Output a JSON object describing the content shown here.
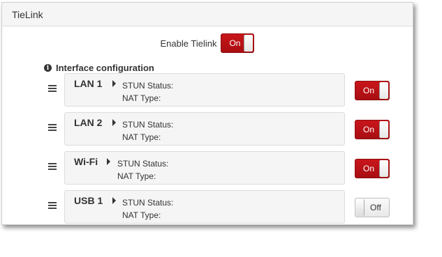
{
  "panel": {
    "title": "TieLink"
  },
  "enable": {
    "label": "Enable Tielink",
    "state": "On"
  },
  "section": {
    "title": "Interface configuration"
  },
  "interfaces": [
    {
      "name": "LAN 1",
      "stun_label": "STUN Status:",
      "nat_label": "NAT Type:",
      "toggle": "On"
    },
    {
      "name": "LAN 2",
      "stun_label": "STUN Status:",
      "nat_label": "NAT Type:",
      "toggle": "On"
    },
    {
      "name": "Wi-Fi",
      "stun_label": "STUN Status:",
      "nat_label": "NAT Type:",
      "toggle": "On"
    },
    {
      "name": "USB 1",
      "stun_label": "STUN Status:",
      "nat_label": "NAT Type:",
      "toggle": "Off"
    }
  ],
  "colors": {
    "toggle_on": "#b5121b",
    "toggle_off": "#eeeeee",
    "row_bg": "#f5f5f5"
  },
  "icons": {
    "info": "info-circle-icon",
    "drag": "drag-handle-icon",
    "expand": "caret-right-icon"
  }
}
